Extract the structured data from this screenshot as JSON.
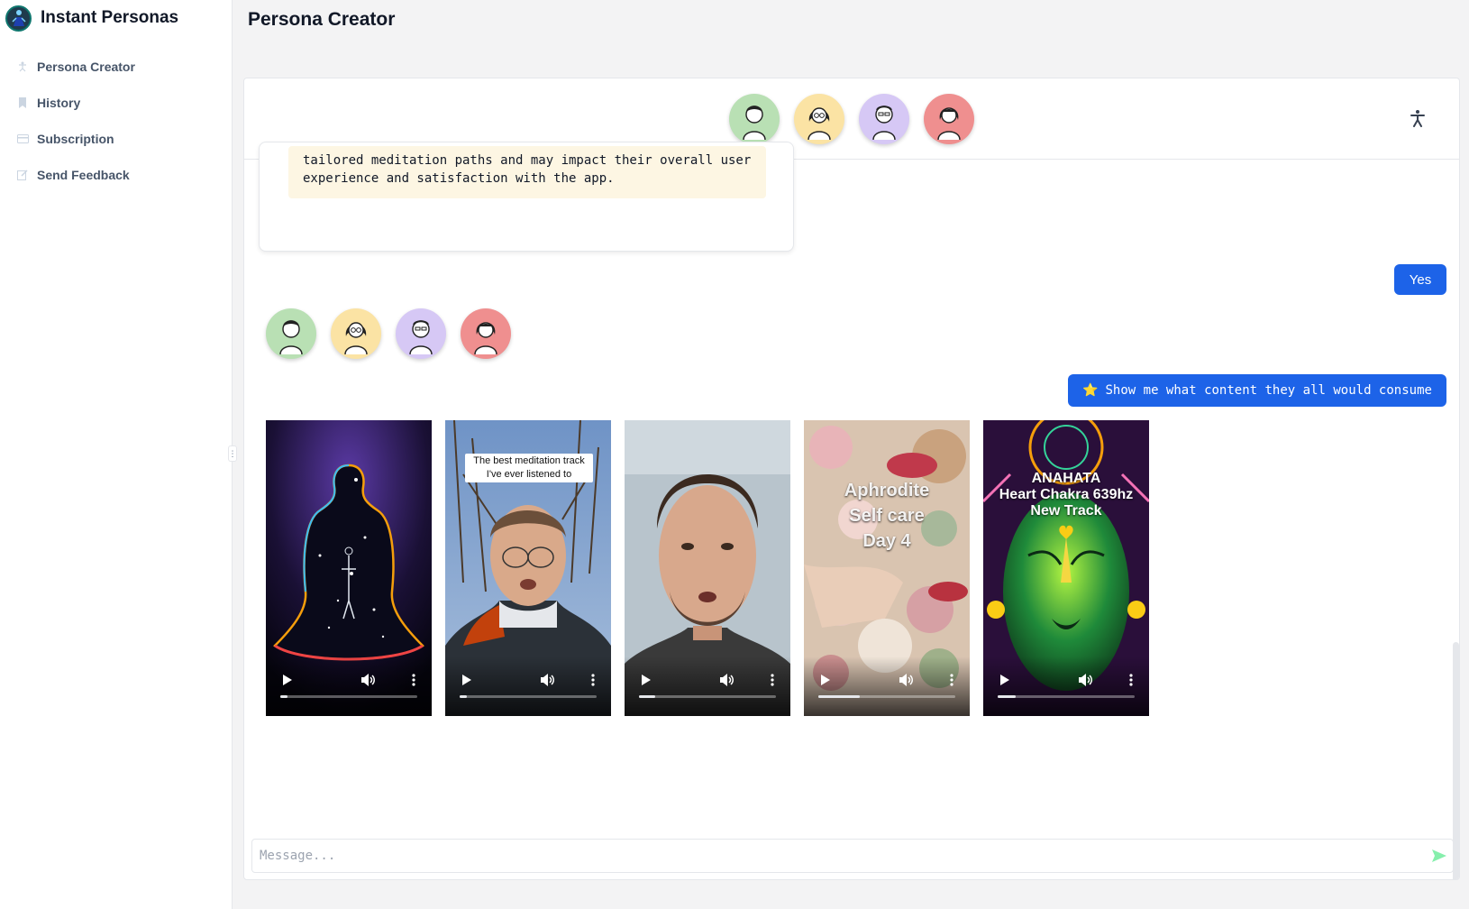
{
  "app": {
    "brand_name": "Instant Personas",
    "logo_icon": "person-globe-icon"
  },
  "sidebar": {
    "items": [
      {
        "label": "Persona Creator",
        "icon": "person-icon"
      },
      {
        "label": "History",
        "icon": "bookmark-icon"
      },
      {
        "label": "Subscription",
        "icon": "credit-card-icon"
      },
      {
        "label": "Send Feedback",
        "icon": "edit-icon"
      }
    ]
  },
  "header": {
    "title": "Persona Creator"
  },
  "personas": [
    {
      "name": "persona-1",
      "color": "#b9e0b4"
    },
    {
      "name": "persona-2",
      "color": "#fbe3a4"
    },
    {
      "name": "persona-3",
      "color": "#d6c8f5"
    },
    {
      "name": "persona-4",
      "color": "#ef8f8f"
    }
  ],
  "chat": {
    "assistant_snippet": "tailored meditation paths and may impact their overall user\nexperience and satisfaction with the app.",
    "user_yes": "Yes",
    "user_show_star": "⭐",
    "user_show_text": "Show me what content they all would consume"
  },
  "videos": [
    {
      "caption": "",
      "overlay": "",
      "progress": 0.05,
      "theme": "cosmic-meditation"
    },
    {
      "caption": "The best meditation track I've ever listened to",
      "overlay": "",
      "progress": 0.05,
      "theme": "woman-outdoors"
    },
    {
      "caption": "",
      "overlay": "",
      "progress": 0.12,
      "theme": "man-closeup"
    },
    {
      "caption": "",
      "overlay": "Aphrodite\nSelf care\nDay 4",
      "progress": 0.3,
      "theme": "floral-collage"
    },
    {
      "caption": "",
      "overlay": "ANAHATA\nHeart Chakra 639hz\nNew Track",
      "progress": 0.13,
      "theme": "green-chakra-face"
    }
  ],
  "composer": {
    "placeholder": "Message...",
    "send_icon": "send-icon"
  },
  "colors": {
    "accent": "#1d63e8",
    "code_bg": "#fdf6e3",
    "send": "#86efac"
  }
}
